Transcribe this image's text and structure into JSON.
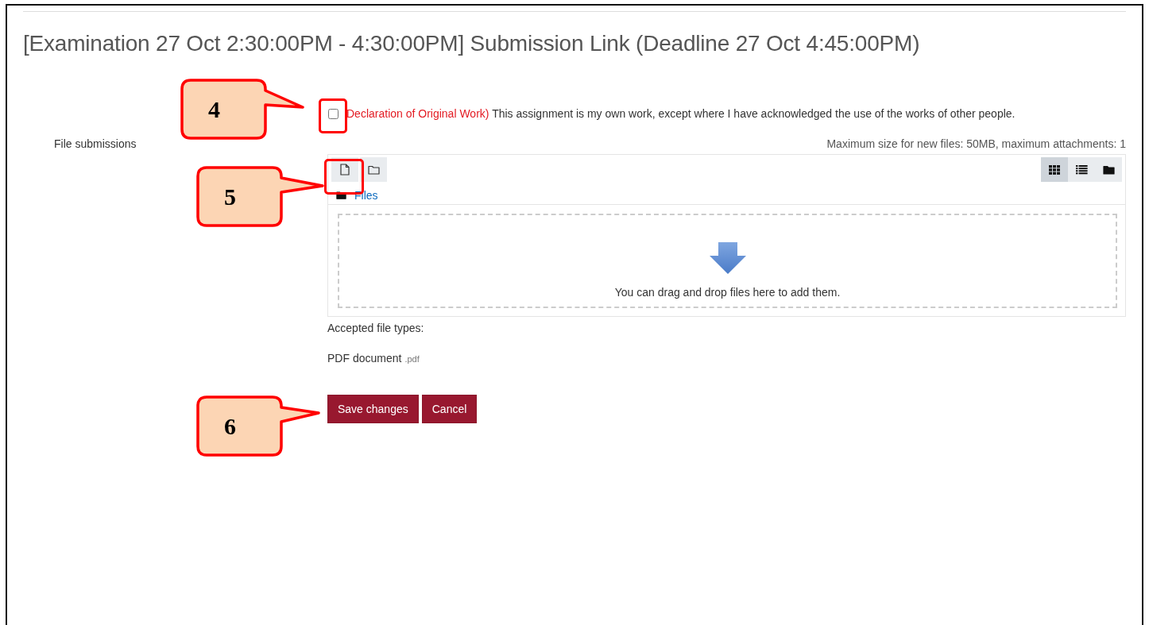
{
  "title": "[Examination 27 Oct 2:30:00PM - 4:30:00PM] Submission Link (Deadline 27 Oct 4:45:00PM)",
  "declaration": {
    "checked": false,
    "label": "Declaration of Original Work)",
    "text": "This assignment is my own work, except where I have acknowledged the use of the works of other people."
  },
  "file_submissions": {
    "label": "File submissions",
    "limits": "Maximum size for new files: 50MB, maximum attachments: 1",
    "toolbar": [
      {
        "kind": "add-file"
      },
      {
        "kind": "create-folder"
      }
    ],
    "view_modes": [
      {
        "kind": "icons",
        "selected": true
      },
      {
        "kind": "list",
        "selected": false
      },
      {
        "kind": "tree",
        "selected": false
      }
    ],
    "path": "Files",
    "drop_hint": "You can drag and drop files here to add them."
  },
  "accepted": {
    "label": "Accepted file types:",
    "type": "PDF document",
    "extension": ".pdf"
  },
  "buttons": [
    "Save changes",
    "Cancel"
  ],
  "callouts": [
    {
      "number": "4"
    },
    {
      "number": "5"
    },
    {
      "number": "6"
    }
  ]
}
